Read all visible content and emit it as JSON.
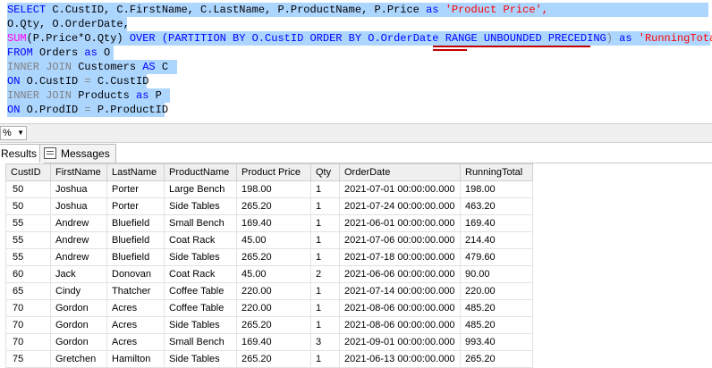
{
  "editor": {
    "line1": {
      "select": "SELECT",
      "cols": " C.CustID, C.FirstName, C.LastName, P.ProductName, P.Price ",
      "as": "as",
      "alias": " 'Product Price',"
    },
    "line2": "O.Qty, O.OrderDate,",
    "line3": {
      "sum": "SUM",
      "expr": "(P.Price*O.Qty) ",
      "over": "OVER",
      "partition": " (PARTITION BY O.CustID ORDER BY O.OrderDate ",
      "range": "RANGE UNBOUNDED PRECEDING",
      "close": ") ",
      "as": "as",
      "alias": " 'RunningTotal'"
    },
    "line4": {
      "from": "FROM",
      "rest": " Orders ",
      "as": "as",
      "alias": " O"
    },
    "line5": {
      "join": "INNER JOIN",
      "rest": " Customers ",
      "as": "AS",
      "alias": " C"
    },
    "line6": {
      "on": "ON",
      "rest": " O.CustID ",
      "eq": "=",
      "rest2": " C.CustID"
    },
    "line7": {
      "join": "INNER JOIN",
      "rest": " Products ",
      "as": "as",
      "alias": " P"
    },
    "line8": {
      "on": "ON",
      "rest": " O.ProdID ",
      "eq": "=",
      "rest2": " P.ProductID"
    }
  },
  "zoom": {
    "value": "%"
  },
  "tabs": {
    "results": "Results",
    "messages": "Messages"
  },
  "grid": {
    "headers": [
      "CustID",
      "FirstName",
      "LastName",
      "ProductName",
      "Product Price",
      "Qty",
      "OrderDate",
      "RunningTotal"
    ],
    "rows": [
      [
        "50",
        "Joshua",
        "Porter",
        "Large Bench",
        "198.00",
        "1",
        "2021-07-01 00:00:00.000",
        "198.00"
      ],
      [
        "50",
        "Joshua",
        "Porter",
        "Side Tables",
        "265.20",
        "1",
        "2021-07-24 00:00:00.000",
        "463.20"
      ],
      [
        "55",
        "Andrew",
        "Bluefield",
        "Small Bench",
        "169.40",
        "1",
        "2021-06-01 00:00:00.000",
        "169.40"
      ],
      [
        "55",
        "Andrew",
        "Bluefield",
        "Coat Rack",
        "45.00",
        "1",
        "2021-07-06 00:00:00.000",
        "214.40"
      ],
      [
        "55",
        "Andrew",
        "Bluefield",
        "Side Tables",
        "265.20",
        "1",
        "2021-07-18 00:00:00.000",
        "479.60"
      ],
      [
        "60",
        "Jack",
        "Donovan",
        "Coat Rack",
        "45.00",
        "2",
        "2021-06-06 00:00:00.000",
        "90.00"
      ],
      [
        "65",
        "Cindy",
        "Thatcher",
        "Coffee Table",
        "220.00",
        "1",
        "2021-07-14 00:00:00.000",
        "220.00"
      ],
      [
        "70",
        "Gordon",
        "Acres",
        "Coffee Table",
        "220.00",
        "1",
        "2021-08-06 00:00:00.000",
        "485.20"
      ],
      [
        "70",
        "Gordon",
        "Acres",
        "Side Tables",
        "265.20",
        "1",
        "2021-08-06 00:00:00.000",
        "485.20"
      ],
      [
        "70",
        "Gordon",
        "Acres",
        "Small Bench",
        "169.40",
        "3",
        "2021-09-01 00:00:00.000",
        "993.40"
      ],
      [
        "75",
        "Gretchen",
        "Hamilton",
        "Side Tables",
        "265.20",
        "1",
        "2021-06-13 00:00:00.000",
        "265.20"
      ]
    ]
  }
}
